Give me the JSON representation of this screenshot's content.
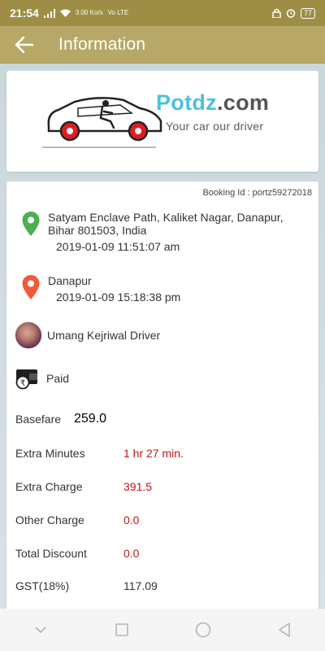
{
  "status_bar": {
    "time": "21:54",
    "network_speed": "3.00 Ko/s",
    "network_type": "Vo LTE",
    "battery": "77"
  },
  "app_bar": {
    "title": "Information"
  },
  "logo": {
    "brand_name": "Potdz",
    "brand_suffix": ".com",
    "tagline": "Your car our driver"
  },
  "booking": {
    "id_text": "Booking Id : portz59272018"
  },
  "pickup": {
    "address": "Satyam Enclave Path, Kaliket Nagar, Danapur, Bihar 801503, India",
    "time": "2019-01-09 11:51:07 am"
  },
  "drop": {
    "address": "Danapur",
    "time": "2019-01-09 15:18:38 pm"
  },
  "driver": {
    "name": "Umang Kejriwal  Driver"
  },
  "payment": {
    "status": "Paid"
  },
  "fare": {
    "basefare": {
      "label": "Basefare",
      "value": "259.0"
    },
    "extra_minutes": {
      "label": "Extra Minutes",
      "value": "1 hr 27 min."
    },
    "extra_charge": {
      "label": "Extra Charge",
      "value": "391.5"
    },
    "other_charge": {
      "label": "Other Charge",
      "value": "0.0"
    },
    "total_discount": {
      "label": "Total Discount",
      "value": "0.0"
    },
    "gst": {
      "label": "GST(18%)",
      "value": "117.09"
    }
  },
  "colors": {
    "app_bar": "#b8a868",
    "status_bar": "#9e8e45",
    "brand_blue": "#4dc0de",
    "highlight_red": "#c21414",
    "pickup_pin": "#4caf50",
    "drop_pin": "#f05a3c"
  }
}
